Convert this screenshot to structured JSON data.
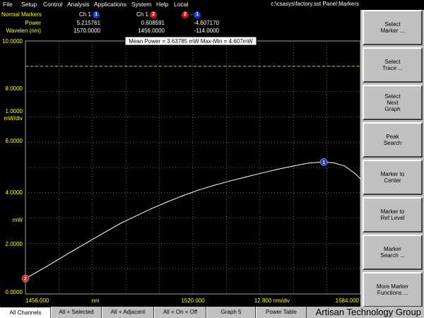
{
  "menu": {
    "items": [
      "File",
      "Setup",
      "Control",
      "Analysis",
      "Applications",
      "System",
      "Help",
      "Local"
    ],
    "path": "c:\\csasys\\factory.sst  Panel:Markers"
  },
  "readout": {
    "title": "Normal Markers",
    "row_labels": [
      "Power",
      "Wavelen (nm)"
    ],
    "col1_header": "Ch 1",
    "col1_marker": "1",
    "col2_header": "Ch 1",
    "col2_marker": "2",
    "col3_marker_a": "2",
    "col3_dash": "-",
    "col3_marker_b": "1",
    "power": [
      "5.215761",
      "0.608591",
      "-4.607170"
    ],
    "wavelength": [
      "1570.0000",
      "1456.0000",
      "-114.0000"
    ]
  },
  "graph": {
    "summary": "Mean Power = 3.63785 mW  Max-Min = 4.607mW",
    "left_labels": [
      "10.0000",
      "8.0000",
      "1.0000",
      "mW/div",
      "6.0000",
      "4.0000",
      "mW",
      "2.0000",
      "0.0000"
    ],
    "bottom_labels": [
      "1456.000",
      "nm",
      "1520.000",
      "12.800 nm/div",
      "1584.000"
    ],
    "marker1": "1",
    "marker2": "2",
    "colors": {
      "trace": "#ffffff",
      "grid": "#808080",
      "ref_line": "#c8c800",
      "axis_text": "#ffff00",
      "marker1": "#1a3cc8",
      "marker2": "#c81a1a"
    }
  },
  "chart_data": {
    "type": "line",
    "x": [
      1456,
      1462,
      1468,
      1474,
      1480,
      1486,
      1492,
      1498,
      1504,
      1510,
      1516,
      1522,
      1528,
      1534,
      1540,
      1546,
      1552,
      1558,
      1564,
      1570,
      1574,
      1578,
      1582,
      1584
    ],
    "values": [
      0.61,
      0.96,
      1.33,
      1.7,
      2.06,
      2.42,
      2.77,
      3.07,
      3.37,
      3.63,
      3.88,
      4.1,
      4.29,
      4.46,
      4.62,
      4.77,
      4.92,
      5.05,
      5.17,
      5.22,
      5.18,
      5.06,
      4.76,
      4.55
    ],
    "xlim": [
      1456,
      1584
    ],
    "ylim": [
      0,
      10
    ],
    "ref_level": 9.0,
    "markers": [
      {
        "id": "1",
        "x": 1570,
        "y": 5.215761
      },
      {
        "id": "2",
        "x": 1456,
        "y": 0.608591
      }
    ],
    "grid": true
  },
  "panel": {
    "buttons": [
      "Select\nMarker ...",
      "Select\nTrace ...",
      "Select\nNext\nGraph",
      "Peak\nSearch",
      "Marker to\nCenter",
      "Marker to\nRef Level",
      "Marker\nSearch ...",
      "More Marker\nFunctions ..."
    ]
  },
  "tabs": [
    "All Channels",
    "All + Selected",
    "All + Adjacent",
    "All + On + Off",
    "Graph 5",
    "Power Table"
  ],
  "watermark": "Artisan Technology Group"
}
